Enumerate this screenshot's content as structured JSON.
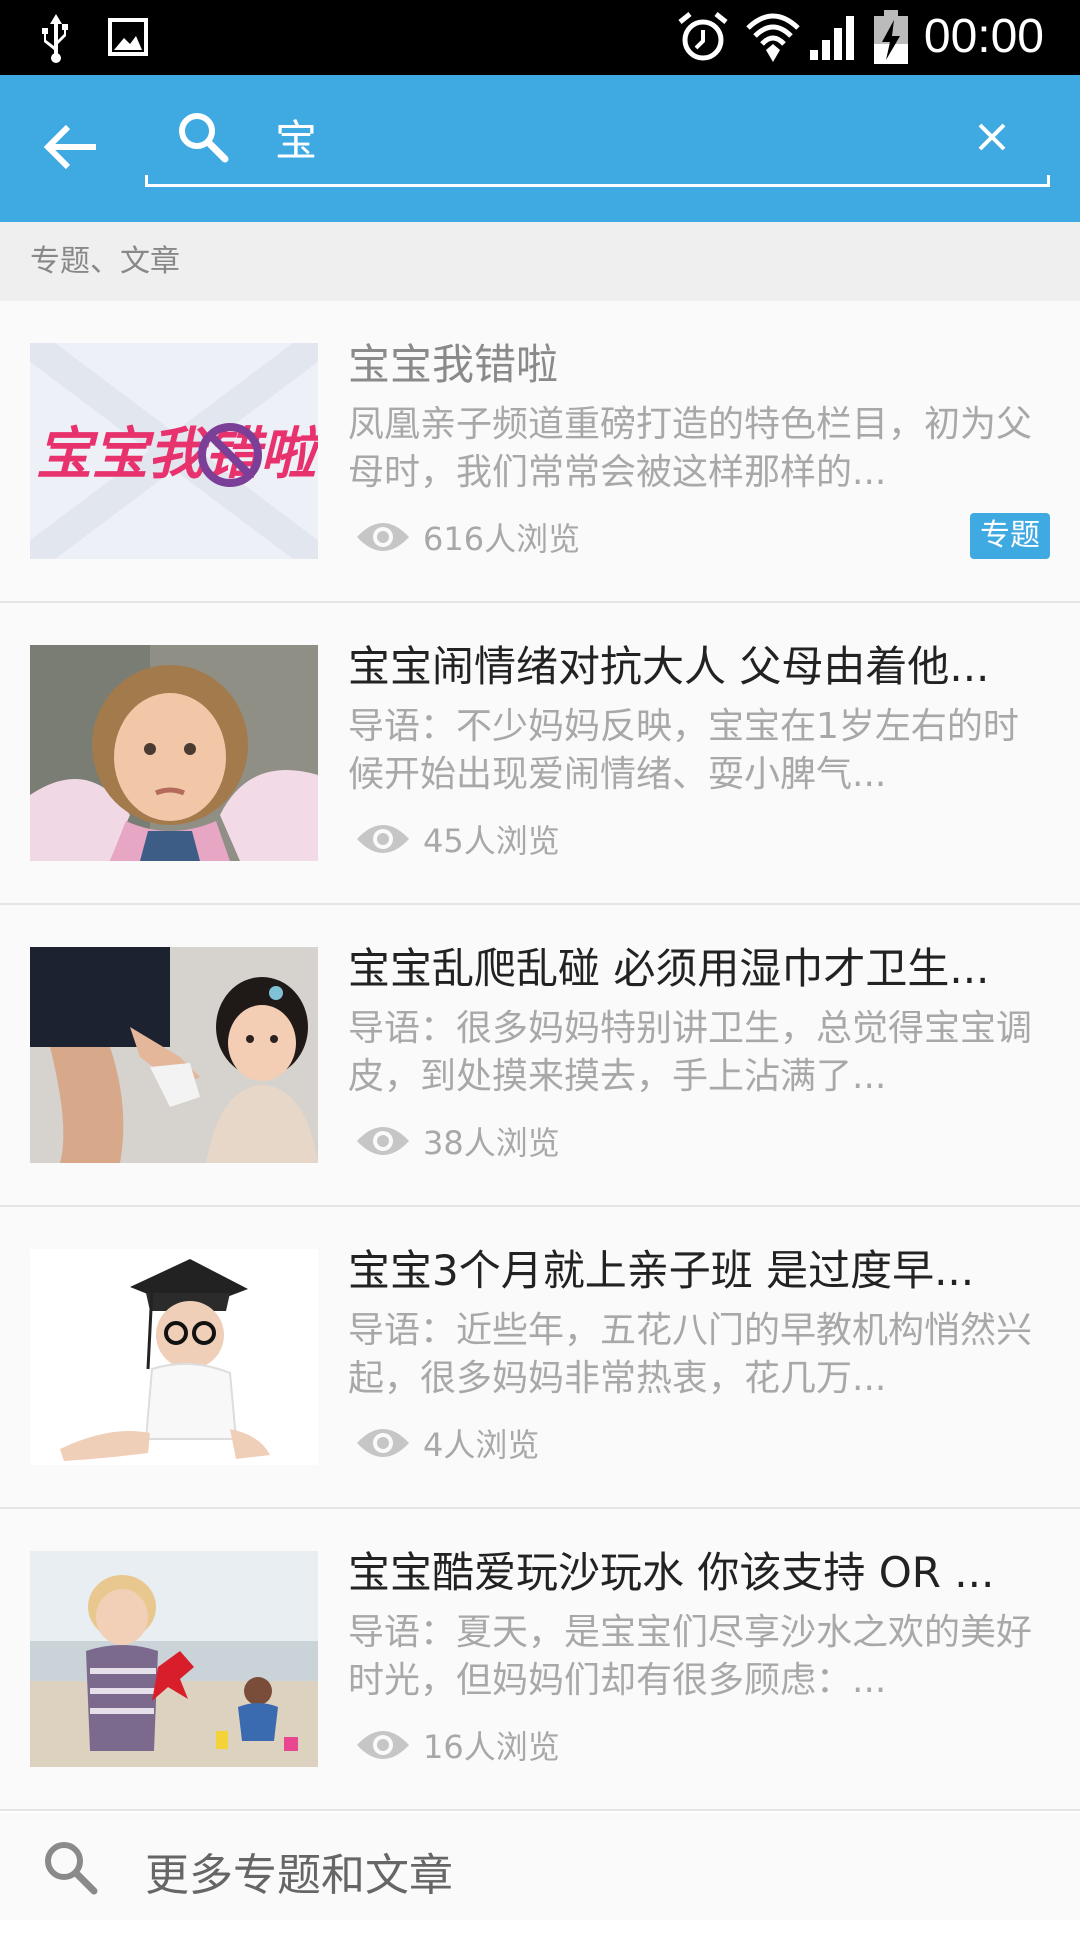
{
  "status_bar": {
    "time": "00:00",
    "icons": [
      "usb-icon",
      "image-icon",
      "alarm-icon",
      "wifi-icon",
      "signal-icon",
      "battery-charging-icon"
    ]
  },
  "header": {
    "back_icon": "back-arrow-icon",
    "search_icon": "search-icon",
    "search_value": "宝",
    "clear_icon": "close-icon"
  },
  "section": {
    "label": "专题、文章"
  },
  "results": [
    {
      "title": "宝宝我错啦",
      "description": "凤凰亲子频道重磅打造的特色栏目，初为父母时，我们常常会被这样那样的...",
      "views": "616人浏览",
      "badge": "专题",
      "thumb_text": "宝宝我错啦"
    },
    {
      "title": "宝宝闹情绪对抗大人 父母由着他...",
      "description": "导语：不少妈妈反映，宝宝在1岁左右的时候开始出现爱闹情绪、耍小脾气...",
      "views": "45人浏览"
    },
    {
      "title": "宝宝乱爬乱碰 必须用湿巾才卫生...",
      "description": "导语：很多妈妈特别讲卫生，总觉得宝宝调皮，到处摸来摸去，手上沾满了...",
      "views": "38人浏览"
    },
    {
      "title": "宝宝3个月就上亲子班 是过度早...",
      "description": "导语：近些年，五花八门的早教机构悄然兴起，很多妈妈非常热衷，花几万...",
      "views": "4人浏览"
    },
    {
      "title": "宝宝酷爱玩沙玩水 你该支持 OR ...",
      "description": "导语：夏天，是宝宝们尽享沙水之欢的美好时光，但妈妈们却有很多顾虑：...",
      "views": "16人浏览"
    }
  ],
  "more": {
    "label": "更多专题和文章",
    "icon": "search-icon"
  },
  "colors": {
    "accent": "#3fa9e1",
    "status_bar": "#000000",
    "section_bg": "#efefef"
  }
}
